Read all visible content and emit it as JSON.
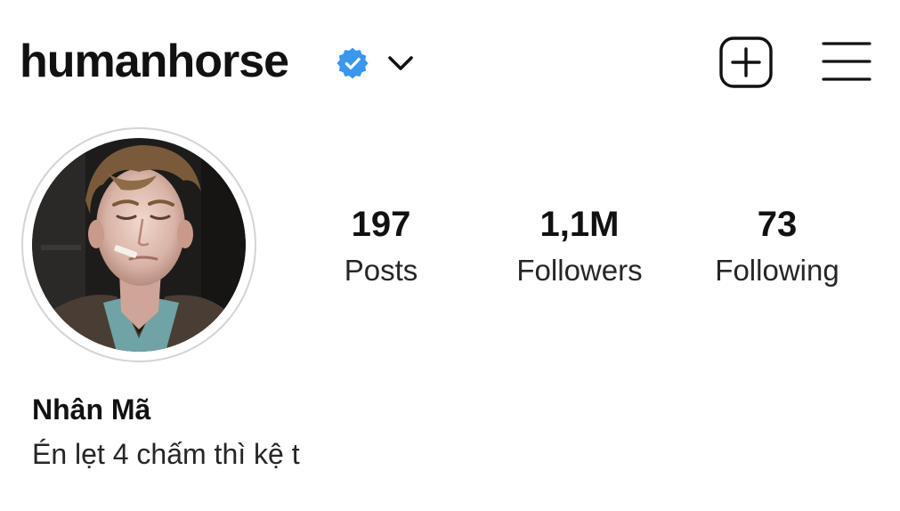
{
  "header": {
    "username": "humanhorse",
    "verified_icon": "verified-badge-icon",
    "verified_color": "#3897f0",
    "dropdown_icon": "chevron-down-icon",
    "add_icon": "new-post-plus-icon",
    "menu_icon": "hamburger-menu-icon"
  },
  "profile": {
    "avatar": "profile-photo",
    "stats": [
      {
        "value": "197",
        "label": "Posts"
      },
      {
        "value": "1,1M",
        "label": "Followers"
      },
      {
        "value": "73",
        "label": "Following"
      }
    ],
    "display_name": "Nhân Mã",
    "bio": "Én lẹt 4 chấm thì kệ t"
  }
}
